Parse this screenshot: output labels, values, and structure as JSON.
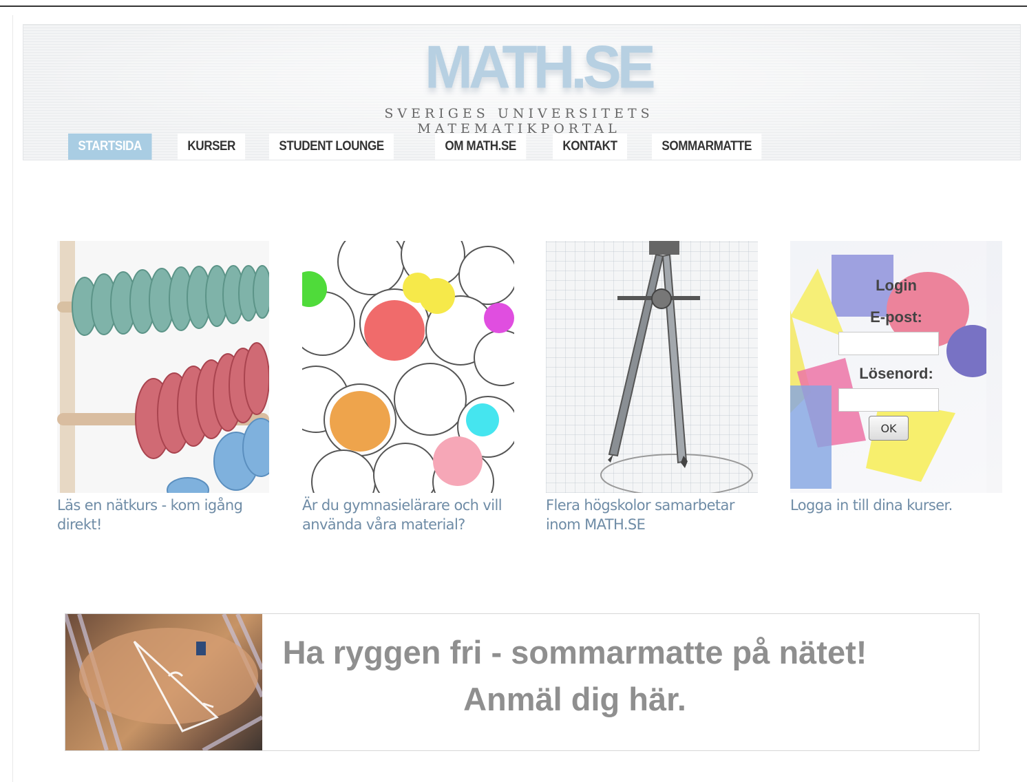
{
  "header": {
    "logo_text": "MATH.SE",
    "tagline": "SVERIGES UNIVERSITETS MATEMATIKPORTAL"
  },
  "nav": {
    "items": [
      {
        "label": "STARTSIDA",
        "active": true
      },
      {
        "label": "KURSER",
        "active": false
      },
      {
        "label": "STUDENT LOUNGE",
        "active": false
      },
      {
        "label": "OM MATH.SE",
        "active": false
      },
      {
        "label": "KONTAKT",
        "active": false
      },
      {
        "label": "SOMMARMATTE",
        "active": false
      }
    ]
  },
  "features": [
    {
      "caption": "Läs en nätkurs - kom igång direkt!",
      "image": "abacus"
    },
    {
      "caption": "Är du gymnasielärare och vill använda våra material?",
      "image": "sphere-circles"
    },
    {
      "caption": "Flera högskolor samarbetar inom MATH.SE",
      "image": "drawing-compass"
    },
    {
      "caption": "Logga in till dina kurser.",
      "image": "geometric-solids"
    }
  ],
  "login": {
    "title": "Login",
    "email_label": "E-post:",
    "password_label": "Lösenord:",
    "submit_label": "OK",
    "email_value": "",
    "password_value": ""
  },
  "banner": {
    "line1": "Ha ryggen fri - sommarmatte på nätet!",
    "line2": "Anmäl dig här.",
    "image": "math-on-back-photo"
  },
  "colors": {
    "accent": "#a9cde3",
    "logo": "#b7d0e2",
    "caption": "#6f8ca6",
    "banner_text": "#8f8f8f"
  }
}
